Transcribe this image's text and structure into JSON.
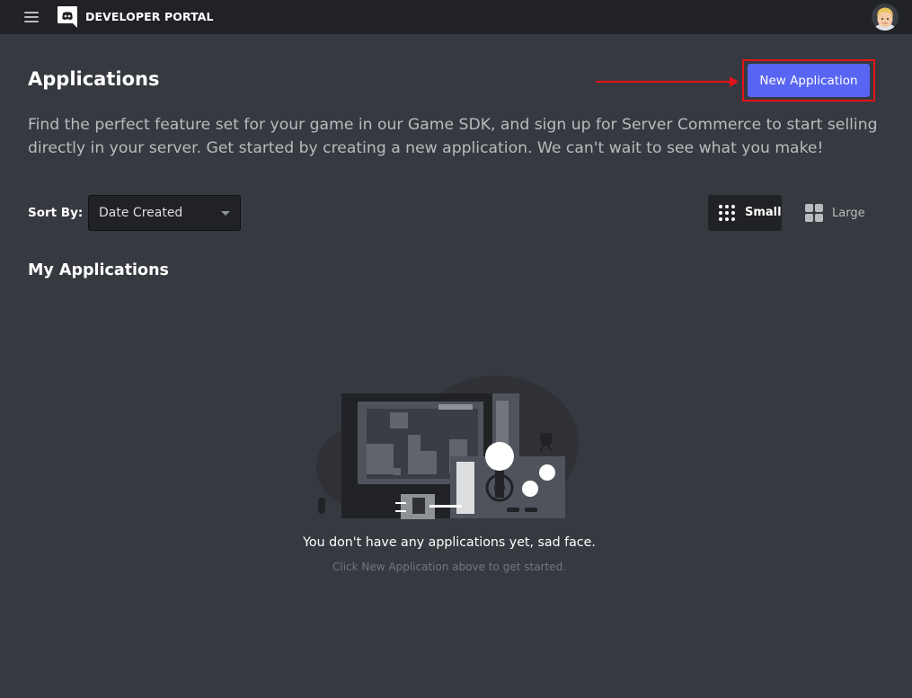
{
  "header": {
    "brand": "DEVELOPER PORTAL",
    "menu_icon": "hamburger-menu-icon",
    "logo_icon": "discord-logo-icon",
    "avatar_icon": "user-avatar-icon"
  },
  "page": {
    "title": "Applications",
    "new_application_label": "New Application",
    "description": "Find the perfect feature set for your game in our Game SDK, and sign up for Server Commerce to start selling directly in your server. Get started by creating a new application. We can't wait to see what you make!"
  },
  "sort": {
    "label": "Sort By:",
    "selected": "Date Created"
  },
  "view_toggle": {
    "small_label": "Small",
    "large_label": "Large",
    "selected": "Small"
  },
  "my_applications": {
    "title": "My Applications",
    "empty_title": "You don't have any applications yet, sad face.",
    "empty_subtitle": "Click New Application above to get started."
  },
  "colors": {
    "background": "#36393f",
    "topbar": "#202225",
    "accent": "#5865f2",
    "annotation_red": "#e3141b"
  }
}
